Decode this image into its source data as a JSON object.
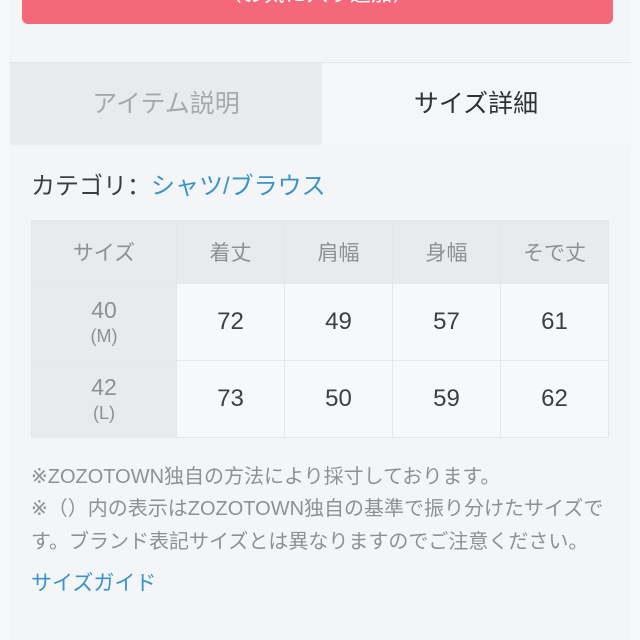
{
  "favorite_button": {
    "label": "（お気に入り追加）"
  },
  "tabs": [
    {
      "label": "アイテム説明",
      "state": "inactive"
    },
    {
      "label": "サイズ詳細",
      "state": "active"
    }
  ],
  "category": {
    "label": "カテゴリ：",
    "value": "シャツ/ブラウス"
  },
  "size_table": {
    "headers": [
      "サイズ",
      "着丈",
      "肩幅",
      "身幅",
      "そで丈"
    ],
    "rows": [
      {
        "size": "40",
        "size_sub": "(M)",
        "values": [
          "72",
          "49",
          "57",
          "61"
        ]
      },
      {
        "size": "42",
        "size_sub": "(L)",
        "values": [
          "73",
          "50",
          "59",
          "62"
        ]
      }
    ]
  },
  "notes": [
    "※ZOZOTOWN独自の方法により採寸しております。",
    "※（）内の表示はZOZOTOWN独自の基準で振り分けたサイズです。ブランド表記サイズとは異なりますのでご注意ください。"
  ],
  "guide_link": {
    "label": "サイズガイド"
  },
  "colors": {
    "accent_pink": "#f4687a",
    "link_blue": "#3a93c8",
    "page_bg": "#f4f5f7",
    "header_cell_bg": "#e9eaeb",
    "body_cell_bg": "#f7f8f9",
    "muted_text": "#8d9093"
  }
}
